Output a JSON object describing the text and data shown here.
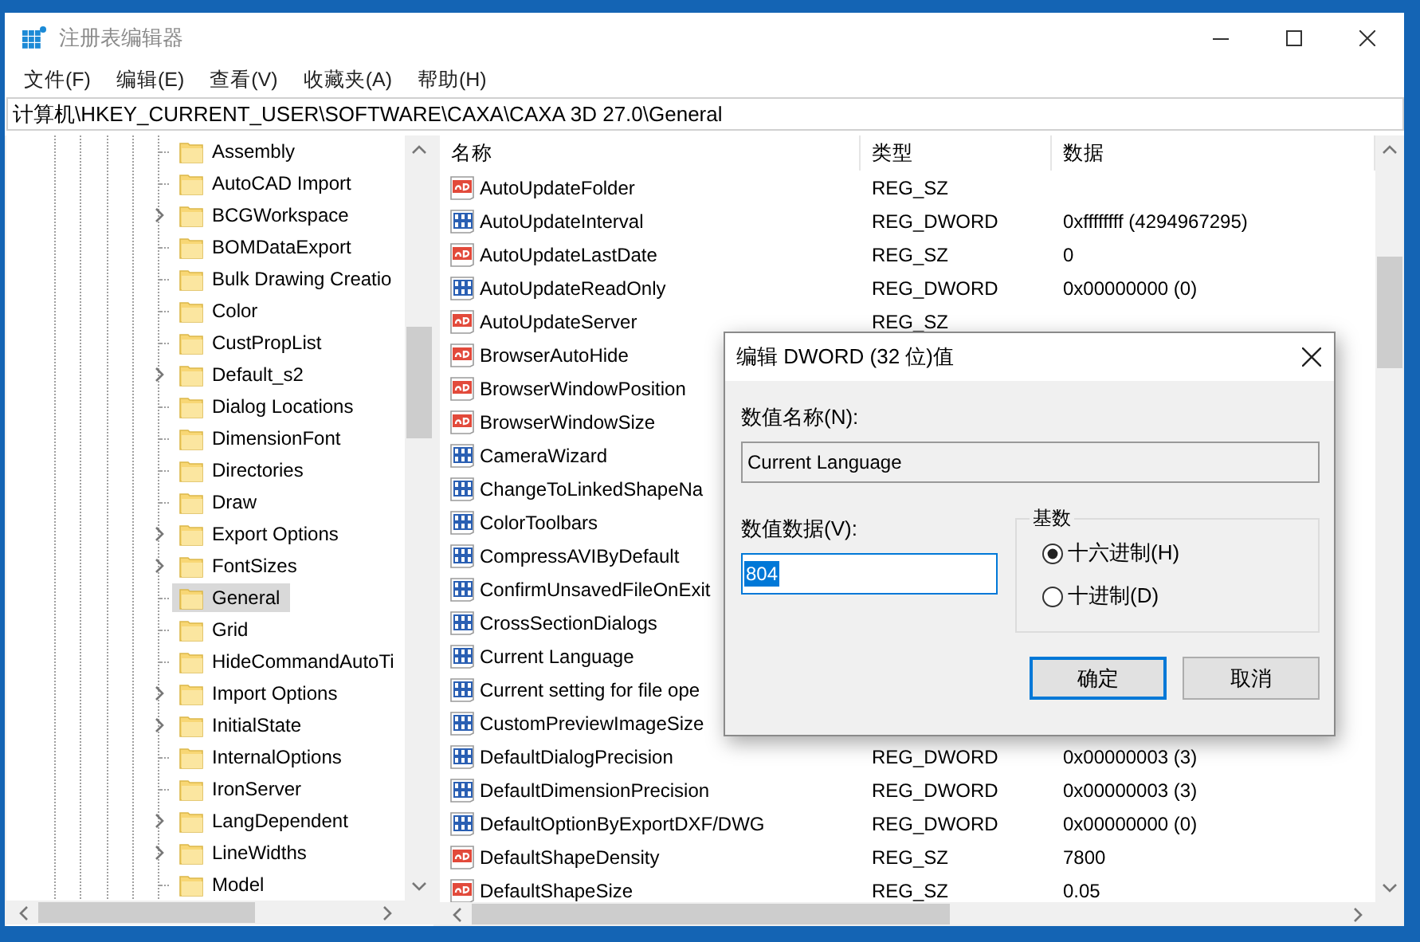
{
  "window": {
    "title": "注册表编辑器"
  },
  "menu": [
    "文件(F)",
    "编辑(E)",
    "查看(V)",
    "收藏夹(A)",
    "帮助(H)"
  ],
  "address": "计算机\\HKEY_CURRENT_USER\\SOFTWARE\\CAXA\\CAXA 3D 27.0\\General",
  "tree": {
    "items": [
      {
        "label": "Assembly",
        "expandable": false,
        "selected": false
      },
      {
        "label": "AutoCAD Import",
        "expandable": false,
        "selected": false
      },
      {
        "label": "BCGWorkspace",
        "expandable": true,
        "selected": false
      },
      {
        "label": "BOMDataExport",
        "expandable": false,
        "selected": false
      },
      {
        "label": "Bulk Drawing Creatio",
        "expandable": false,
        "selected": false
      },
      {
        "label": "Color",
        "expandable": false,
        "selected": false
      },
      {
        "label": "CustPropList",
        "expandable": false,
        "selected": false
      },
      {
        "label": "Default_s2",
        "expandable": true,
        "selected": false
      },
      {
        "label": "Dialog Locations",
        "expandable": false,
        "selected": false
      },
      {
        "label": "DimensionFont",
        "expandable": false,
        "selected": false
      },
      {
        "label": "Directories",
        "expandable": false,
        "selected": false
      },
      {
        "label": "Draw",
        "expandable": false,
        "selected": false
      },
      {
        "label": "Export Options",
        "expandable": true,
        "selected": false
      },
      {
        "label": "FontSizes",
        "expandable": true,
        "selected": false
      },
      {
        "label": "General",
        "expandable": false,
        "selected": true
      },
      {
        "label": "Grid",
        "expandable": false,
        "selected": false
      },
      {
        "label": "HideCommandAutoTi",
        "expandable": false,
        "selected": false
      },
      {
        "label": "Import Options",
        "expandable": true,
        "selected": false
      },
      {
        "label": "InitialState",
        "expandable": true,
        "selected": false
      },
      {
        "label": "InternalOptions",
        "expandable": false,
        "selected": false
      },
      {
        "label": "IronServer",
        "expandable": false,
        "selected": false
      },
      {
        "label": "LangDependent",
        "expandable": true,
        "selected": false
      },
      {
        "label": "LineWidths",
        "expandable": true,
        "selected": false
      },
      {
        "label": "Model",
        "expandable": false,
        "selected": false
      }
    ]
  },
  "values": {
    "columns": [
      "名称",
      "类型",
      "数据"
    ],
    "rows": [
      {
        "kind": "sz",
        "name": "AutoUpdateFolder",
        "type": "REG_SZ"
      },
      {
        "kind": "dword",
        "name": "AutoUpdateInterval",
        "type": "REG_DWORD",
        "data": "0xffffffff (4294967295)"
      },
      {
        "kind": "sz",
        "name": "AutoUpdateLastDate",
        "type": "REG_SZ",
        "data": "0"
      },
      {
        "kind": "dword",
        "name": "AutoUpdateReadOnly",
        "type": "REG_DWORD",
        "data": "0x00000000 (0)"
      },
      {
        "kind": "sz",
        "name": "AutoUpdateServer",
        "type": "REG_SZ"
      },
      {
        "kind": "sz",
        "name": "BrowserAutoHide"
      },
      {
        "kind": "sz",
        "name": "BrowserWindowPosition"
      },
      {
        "kind": "sz",
        "name": "BrowserWindowSize"
      },
      {
        "kind": "dword",
        "name": "CameraWizard"
      },
      {
        "kind": "dword",
        "name": "ChangeToLinkedShapeNa"
      },
      {
        "kind": "dword",
        "name": "ColorToolbars"
      },
      {
        "kind": "dword",
        "name": "CompressAVIByDefault"
      },
      {
        "kind": "dword",
        "name": "ConfirmUnsavedFileOnExit"
      },
      {
        "kind": "dword",
        "name": "CrossSectionDialogs"
      },
      {
        "kind": "dword",
        "name": "Current Language"
      },
      {
        "kind": "dword",
        "name": "Current setting for file ope"
      },
      {
        "kind": "dword",
        "name": "CustomPreviewImageSize"
      },
      {
        "kind": "dword",
        "name": "DefaultDialogPrecision",
        "type": "REG_DWORD",
        "data": "0x00000003 (3)"
      },
      {
        "kind": "dword",
        "name": "DefaultDimensionPrecision",
        "type": "REG_DWORD",
        "data": "0x00000003 (3)"
      },
      {
        "kind": "dword",
        "name": "DefaultOptionByExportDXF/DWG",
        "type": "REG_DWORD",
        "data": "0x00000000 (0)"
      },
      {
        "kind": "sz",
        "name": "DefaultShapeDensity",
        "type": "REG_SZ",
        "data": "7800"
      },
      {
        "kind": "sz",
        "name": "DefaultShapeSize",
        "type": "REG_SZ",
        "data": "0.05"
      }
    ]
  },
  "dialog": {
    "title": "编辑 DWORD (32 位)值",
    "name_label": "数值名称(N):",
    "name_value": "Current Language",
    "data_label": "数值数据(V):",
    "data_value": "804",
    "data_text_selected": true,
    "base_label": "基数",
    "bases": [
      {
        "label": "十六进制(H)",
        "selected": true
      },
      {
        "label": "十进制(D)",
        "selected": false
      }
    ],
    "buttons": [
      {
        "label": "确定",
        "default": true
      },
      {
        "label": "取消",
        "default": false
      }
    ]
  }
}
